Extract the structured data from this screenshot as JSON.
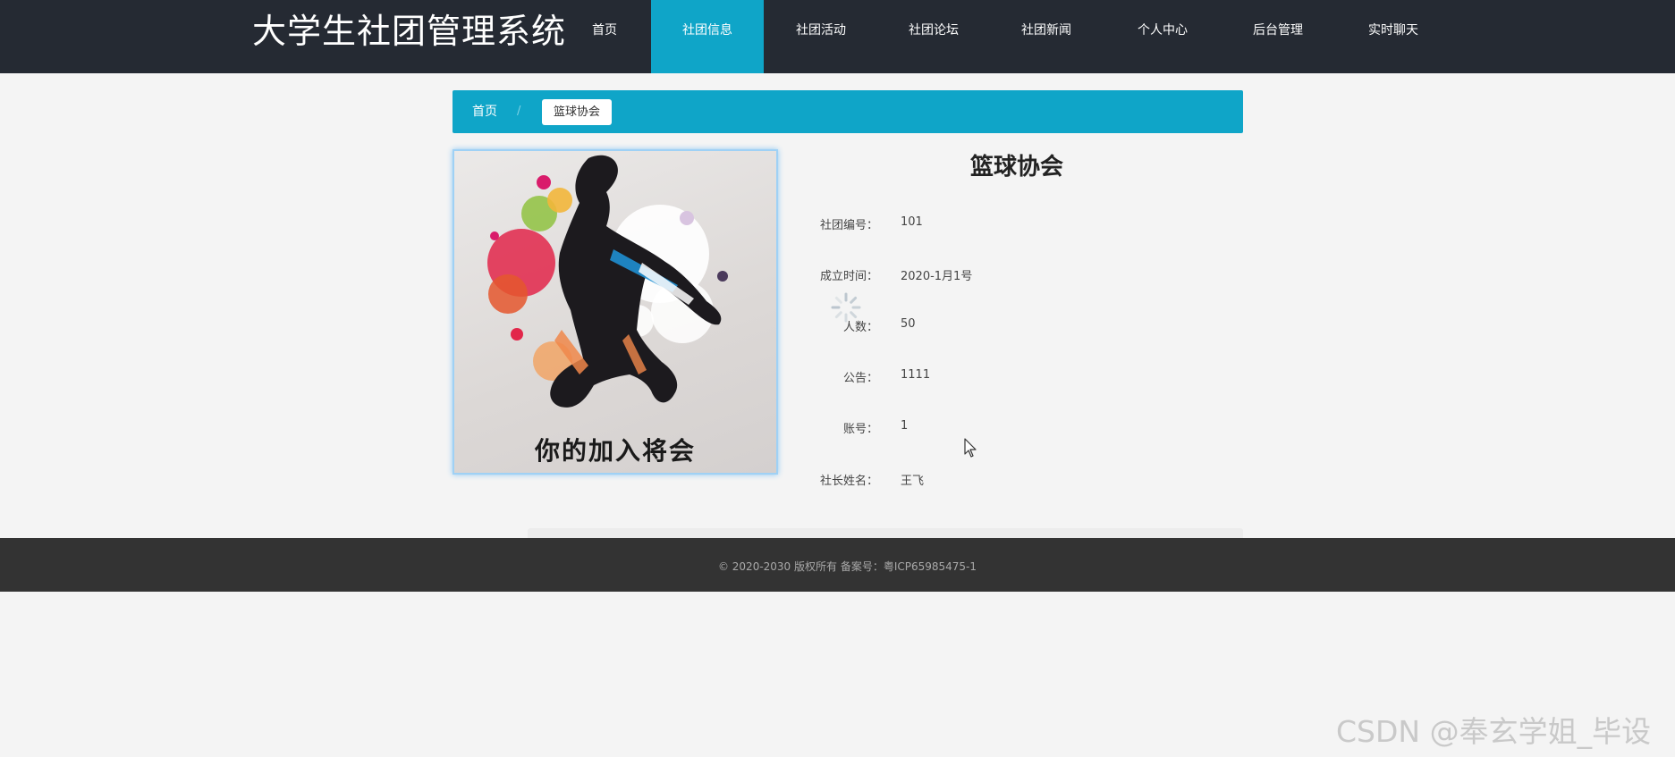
{
  "header": {
    "site_title": "大学生社团管理系统",
    "nav": [
      {
        "label": "首页",
        "active": false
      },
      {
        "label": "社团信息",
        "active": true
      },
      {
        "label": "社团活动",
        "active": false
      },
      {
        "label": "社团论坛",
        "active": false
      },
      {
        "label": "社团新闻",
        "active": false
      },
      {
        "label": "个人中心",
        "active": false
      },
      {
        "label": "后台管理",
        "active": false
      },
      {
        "label": "实时聊天",
        "active": false
      }
    ]
  },
  "breadcrumb": {
    "home": "首页",
    "separator": "/",
    "current": "篮球协会"
  },
  "club": {
    "image_text": "你的加入将会",
    "name": "篮球协会",
    "fields": [
      {
        "label": "社团编号：",
        "value": "101"
      },
      {
        "label": "成立时间：",
        "value": "2020-1月1号"
      },
      {
        "label": "人数：",
        "value": "50"
      },
      {
        "label": "公告：",
        "value": "1111"
      },
      {
        "label": "账号：",
        "value": "1"
      },
      {
        "label": "社长姓名：",
        "value": "王飞"
      }
    ]
  },
  "footer": {
    "text": "© 2020-2030 版权所有 备案号：粤ICP65985475-1"
  },
  "watermark": "CSDN @奉玄学姐_毕设",
  "colors": {
    "header_bg": "#252a33",
    "accent": "#0fa5c8",
    "footer_bg": "#333333",
    "page_bg": "#f4f4f4"
  }
}
